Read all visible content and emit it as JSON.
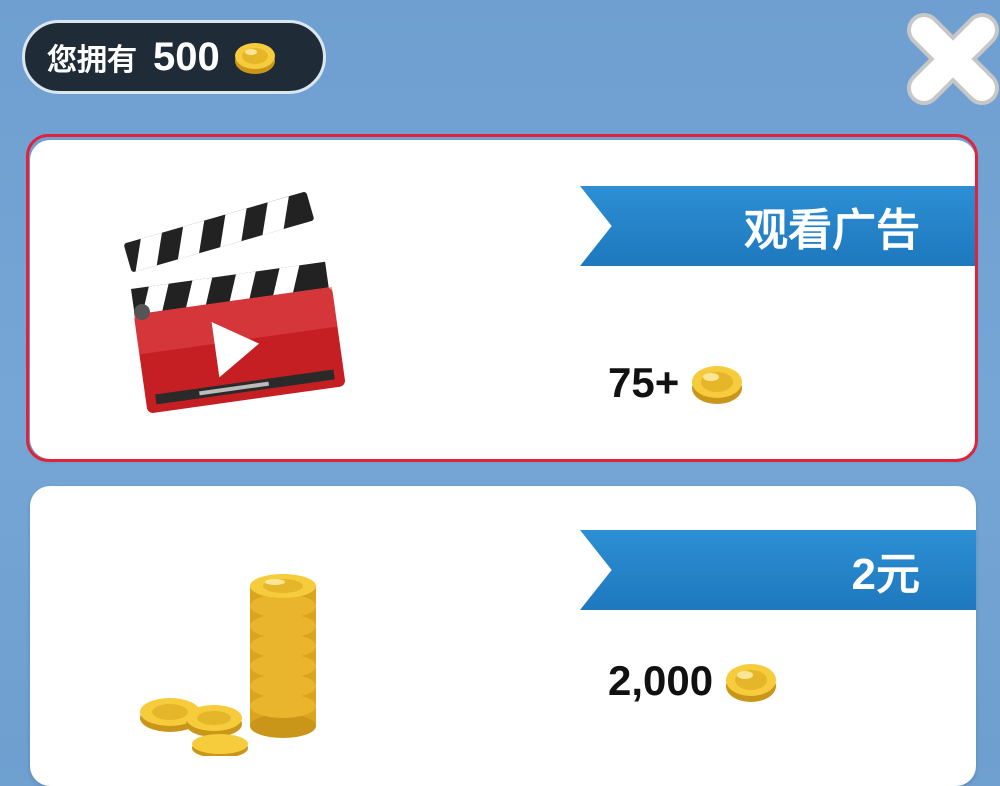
{
  "balance": {
    "label": "您拥有",
    "amount": "500"
  },
  "offers": [
    {
      "title": "观看广告",
      "reward": "75+",
      "image_icon": "video-clapperboard-icon"
    },
    {
      "title": "2元",
      "reward": "2,000",
      "image_icon": "coin-stack-icon"
    }
  ],
  "close_icon": "close-x-icon",
  "colors": {
    "background": "#76a6d6",
    "ribbon": "#1e78be",
    "highlight": "#e0223a",
    "coin": "#f2c230",
    "pill": "#1f2b36"
  }
}
